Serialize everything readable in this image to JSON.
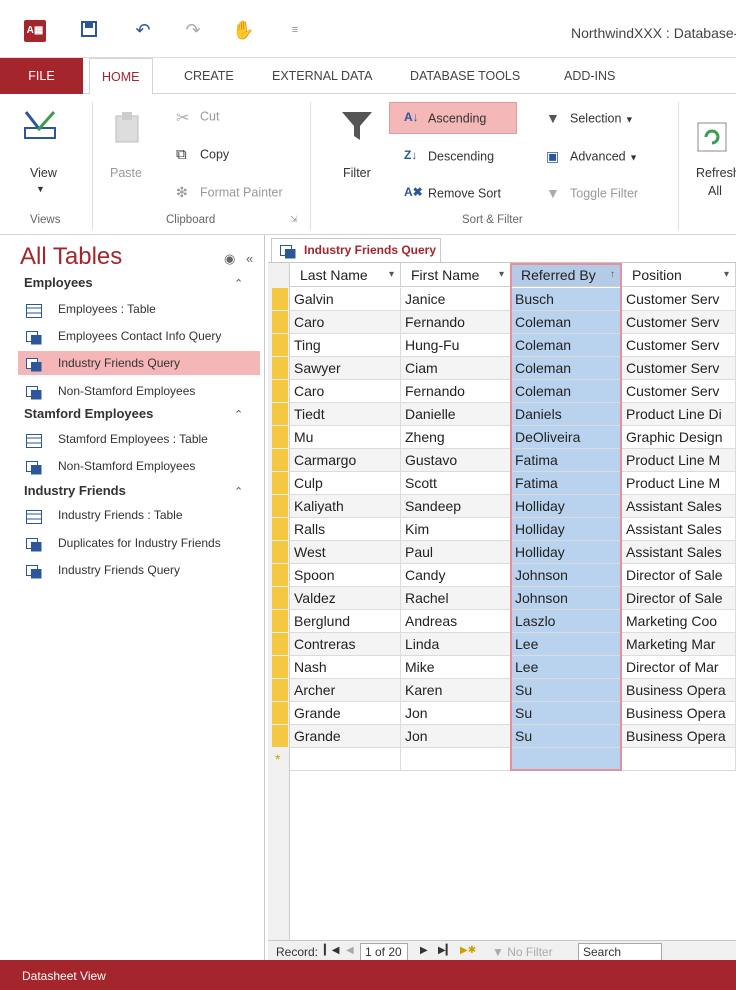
{
  "window": {
    "title": "NorthwindXXX : Database-",
    "app_icon": "A▦",
    "quick_access": [
      "save-icon",
      "undo-icon",
      "redo-icon",
      "touch-mode-icon",
      "customize-icon"
    ]
  },
  "ribbon_tabs": [
    "FILE",
    "HOME",
    "CREATE",
    "EXTERNAL DATA",
    "DATABASE TOOLS",
    "ADD-INS"
  ],
  "ribbon": {
    "views": {
      "view_label": "View",
      "group": "Views"
    },
    "clipboard": {
      "paste": "Paste",
      "cut": "Cut",
      "copy": "Copy",
      "format_painter": "Format Painter",
      "group": "Clipboard"
    },
    "sort_filter": {
      "filter": "Filter",
      "ascending": "Ascending",
      "descending": "Descending",
      "remove_sort": "Remove Sort",
      "selection": "Selection",
      "advanced": "Advanced",
      "toggle_filter": "Toggle Filter",
      "group": "Sort & Filter"
    },
    "records": {
      "refresh": "Refresh",
      "refresh_all": "All"
    }
  },
  "nav": {
    "title": "All Tables",
    "groups": [
      {
        "label": "Employees",
        "items": [
          {
            "label": "Employees : Table",
            "type": "table"
          },
          {
            "label": "Employees Contact Info Query",
            "type": "query"
          },
          {
            "label": "Industry Friends Query",
            "type": "query",
            "selected": true
          },
          {
            "label": "Non-Stamford Employees",
            "type": "query"
          }
        ]
      },
      {
        "label": "Stamford Employees",
        "items": [
          {
            "label": "Stamford Employees : Table",
            "type": "table"
          },
          {
            "label": "Non-Stamford Employees",
            "type": "query"
          }
        ]
      },
      {
        "label": "Industry Friends",
        "items": [
          {
            "label": "Industry Friends : Table",
            "type": "table"
          },
          {
            "label": "Duplicates for Industry Friends",
            "type": "query"
          },
          {
            "label": "Industry Friends Query",
            "type": "query"
          }
        ]
      }
    ]
  },
  "datasheet": {
    "tab_label": "Industry Friends Query",
    "columns": [
      "Last Name",
      "First Name",
      "Referred By",
      "Position"
    ],
    "sorted_column": "Referred By",
    "rows": [
      [
        "Galvin",
        "Janice",
        "Busch",
        "Customer Serv"
      ],
      [
        "Caro",
        "Fernando",
        "Coleman",
        "Customer Serv"
      ],
      [
        "Ting",
        "Hung-Fu",
        "Coleman",
        "Customer Serv"
      ],
      [
        "Sawyer",
        "Ciam",
        "Coleman",
        "Customer Serv"
      ],
      [
        "Caro",
        "Fernando",
        "Coleman",
        "Customer Serv"
      ],
      [
        "Tiedt",
        "Danielle",
        "Daniels",
        "Product Line Di"
      ],
      [
        "Mu",
        "Zheng",
        "DeOliveira",
        "Graphic Design"
      ],
      [
        "Carmargo",
        "Gustavo",
        "Fatima",
        "Product Line M"
      ],
      [
        "Culp",
        "Scott",
        "Fatima",
        "Product Line M"
      ],
      [
        "Kaliyath",
        "Sandeep",
        "Holliday",
        "Assistant Sales"
      ],
      [
        "Ralls",
        "Kim",
        "Holliday",
        "Assistant Sales"
      ],
      [
        "West",
        "Paul",
        "Holliday",
        "Assistant Sales"
      ],
      [
        "Spoon",
        "Candy",
        "Johnson",
        "Director of Sale"
      ],
      [
        "Valdez",
        "Rachel",
        "Johnson",
        "Director of Sale"
      ],
      [
        "Berglund",
        "Andreas",
        "Laszlo",
        "Marketing Coo"
      ],
      [
        "Contreras",
        "Linda",
        "Lee",
        "Marketing Mar"
      ],
      [
        "Nash",
        "Mike",
        "Lee",
        "Director of Mar"
      ],
      [
        "Archer",
        "Karen",
        "Su",
        "Business Opera"
      ],
      [
        "Grande",
        "Jon",
        "Su",
        "Business Opera"
      ],
      [
        "Grande",
        "Jon",
        "Su",
        "Business Opera"
      ]
    ],
    "new_row_marker": "*"
  },
  "record_nav": {
    "label": "Record:",
    "position": "1 of 20",
    "no_filter": "No Filter",
    "search": "Search"
  },
  "status_bar": {
    "text": "Datasheet View"
  },
  "colors": {
    "accent": "#a4262c",
    "selection": "#b9d3ee",
    "nav_selected": "#f5b6b7"
  }
}
